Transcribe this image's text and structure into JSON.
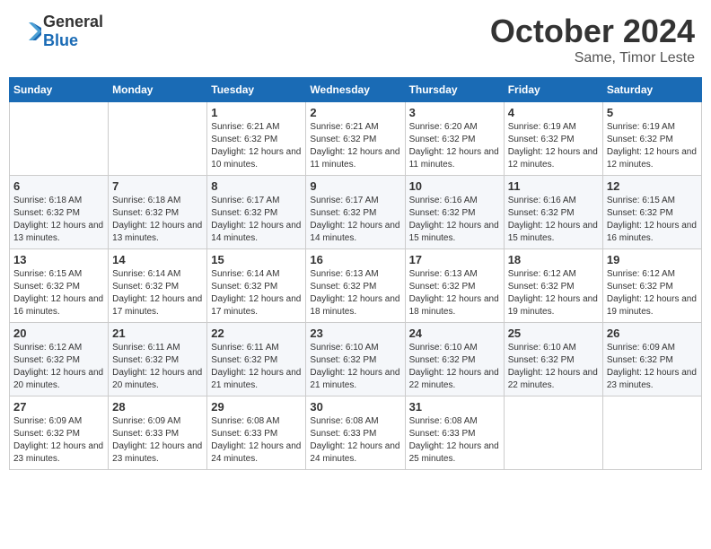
{
  "header": {
    "logo_line1": "General",
    "logo_line2": "Blue",
    "month": "October 2024",
    "location": "Same, Timor Leste"
  },
  "weekdays": [
    "Sunday",
    "Monday",
    "Tuesday",
    "Wednesday",
    "Thursday",
    "Friday",
    "Saturday"
  ],
  "weeks": [
    [
      null,
      null,
      {
        "day": 1,
        "sunrise": "6:21 AM",
        "sunset": "6:32 PM",
        "daylight": "12 hours and 10 minutes."
      },
      {
        "day": 2,
        "sunrise": "6:21 AM",
        "sunset": "6:32 PM",
        "daylight": "12 hours and 11 minutes."
      },
      {
        "day": 3,
        "sunrise": "6:20 AM",
        "sunset": "6:32 PM",
        "daylight": "12 hours and 11 minutes."
      },
      {
        "day": 4,
        "sunrise": "6:19 AM",
        "sunset": "6:32 PM",
        "daylight": "12 hours and 12 minutes."
      },
      {
        "day": 5,
        "sunrise": "6:19 AM",
        "sunset": "6:32 PM",
        "daylight": "12 hours and 12 minutes."
      }
    ],
    [
      {
        "day": 6,
        "sunrise": "6:18 AM",
        "sunset": "6:32 PM",
        "daylight": "12 hours and 13 minutes."
      },
      {
        "day": 7,
        "sunrise": "6:18 AM",
        "sunset": "6:32 PM",
        "daylight": "12 hours and 13 minutes."
      },
      {
        "day": 8,
        "sunrise": "6:17 AM",
        "sunset": "6:32 PM",
        "daylight": "12 hours and 14 minutes."
      },
      {
        "day": 9,
        "sunrise": "6:17 AM",
        "sunset": "6:32 PM",
        "daylight": "12 hours and 14 minutes."
      },
      {
        "day": 10,
        "sunrise": "6:16 AM",
        "sunset": "6:32 PM",
        "daylight": "12 hours and 15 minutes."
      },
      {
        "day": 11,
        "sunrise": "6:16 AM",
        "sunset": "6:32 PM",
        "daylight": "12 hours and 15 minutes."
      },
      {
        "day": 12,
        "sunrise": "6:15 AM",
        "sunset": "6:32 PM",
        "daylight": "12 hours and 16 minutes."
      }
    ],
    [
      {
        "day": 13,
        "sunrise": "6:15 AM",
        "sunset": "6:32 PM",
        "daylight": "12 hours and 16 minutes."
      },
      {
        "day": 14,
        "sunrise": "6:14 AM",
        "sunset": "6:32 PM",
        "daylight": "12 hours and 17 minutes."
      },
      {
        "day": 15,
        "sunrise": "6:14 AM",
        "sunset": "6:32 PM",
        "daylight": "12 hours and 17 minutes."
      },
      {
        "day": 16,
        "sunrise": "6:13 AM",
        "sunset": "6:32 PM",
        "daylight": "12 hours and 18 minutes."
      },
      {
        "day": 17,
        "sunrise": "6:13 AM",
        "sunset": "6:32 PM",
        "daylight": "12 hours and 18 minutes."
      },
      {
        "day": 18,
        "sunrise": "6:12 AM",
        "sunset": "6:32 PM",
        "daylight": "12 hours and 19 minutes."
      },
      {
        "day": 19,
        "sunrise": "6:12 AM",
        "sunset": "6:32 PM",
        "daylight": "12 hours and 19 minutes."
      }
    ],
    [
      {
        "day": 20,
        "sunrise": "6:12 AM",
        "sunset": "6:32 PM",
        "daylight": "12 hours and 20 minutes."
      },
      {
        "day": 21,
        "sunrise": "6:11 AM",
        "sunset": "6:32 PM",
        "daylight": "12 hours and 20 minutes."
      },
      {
        "day": 22,
        "sunrise": "6:11 AM",
        "sunset": "6:32 PM",
        "daylight": "12 hours and 21 minutes."
      },
      {
        "day": 23,
        "sunrise": "6:10 AM",
        "sunset": "6:32 PM",
        "daylight": "12 hours and 21 minutes."
      },
      {
        "day": 24,
        "sunrise": "6:10 AM",
        "sunset": "6:32 PM",
        "daylight": "12 hours and 22 minutes."
      },
      {
        "day": 25,
        "sunrise": "6:10 AM",
        "sunset": "6:32 PM",
        "daylight": "12 hours and 22 minutes."
      },
      {
        "day": 26,
        "sunrise": "6:09 AM",
        "sunset": "6:32 PM",
        "daylight": "12 hours and 23 minutes."
      }
    ],
    [
      {
        "day": 27,
        "sunrise": "6:09 AM",
        "sunset": "6:32 PM",
        "daylight": "12 hours and 23 minutes."
      },
      {
        "day": 28,
        "sunrise": "6:09 AM",
        "sunset": "6:33 PM",
        "daylight": "12 hours and 23 minutes."
      },
      {
        "day": 29,
        "sunrise": "6:08 AM",
        "sunset": "6:33 PM",
        "daylight": "12 hours and 24 minutes."
      },
      {
        "day": 30,
        "sunrise": "6:08 AM",
        "sunset": "6:33 PM",
        "daylight": "12 hours and 24 minutes."
      },
      {
        "day": 31,
        "sunrise": "6:08 AM",
        "sunset": "6:33 PM",
        "daylight": "12 hours and 25 minutes."
      },
      null,
      null
    ]
  ]
}
